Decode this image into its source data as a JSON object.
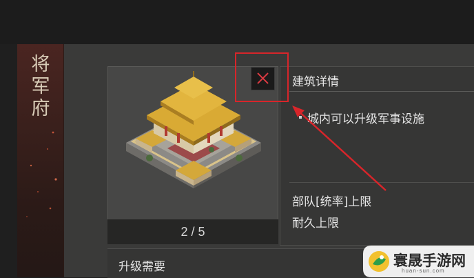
{
  "title_chars": [
    "将",
    "军",
    "府"
  ],
  "building": {
    "level_text": "2 / 5"
  },
  "details": {
    "header": "建筑详情",
    "description": "城内可以升级军事设施",
    "stat_1": "部队[统率]上限",
    "stat_2": "耐久上限"
  },
  "upgrade": {
    "header": "升级需要"
  },
  "close_button": {
    "icon": "close-x-icon"
  },
  "watermark": {
    "text": "寰晟手游网",
    "url_text": "huan-sun.com"
  },
  "colors": {
    "highlight": "#d8252a",
    "close_x": "#d93a42",
    "panel_bg": "#3a3a39"
  }
}
